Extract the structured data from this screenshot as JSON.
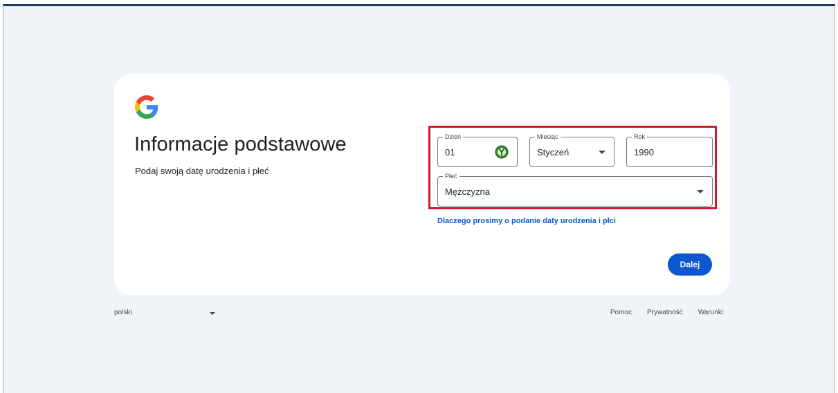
{
  "card": {
    "title": "Informacje podstawowe",
    "subtitle": "Podaj swoją datę urodzenia i płeć"
  },
  "birthdate": {
    "day": {
      "label": "Dzień",
      "value": "01"
    },
    "month": {
      "label": "Miesiąc",
      "value": "Styczeń"
    },
    "year": {
      "label": "Rok",
      "value": "1990"
    }
  },
  "gender": {
    "label": "Płeć",
    "value": "Mężczyzna"
  },
  "why_link": "Dlaczego prosimy o podanie daty urodzenia i płci",
  "next_button": "Dalej",
  "footer": {
    "language": "polski",
    "help": "Pomoc",
    "privacy": "Prywatność",
    "terms": "Warunki"
  },
  "colors": {
    "accent": "#0b57d0",
    "highlight": "#d1192a",
    "background": "#f0f4f9"
  }
}
